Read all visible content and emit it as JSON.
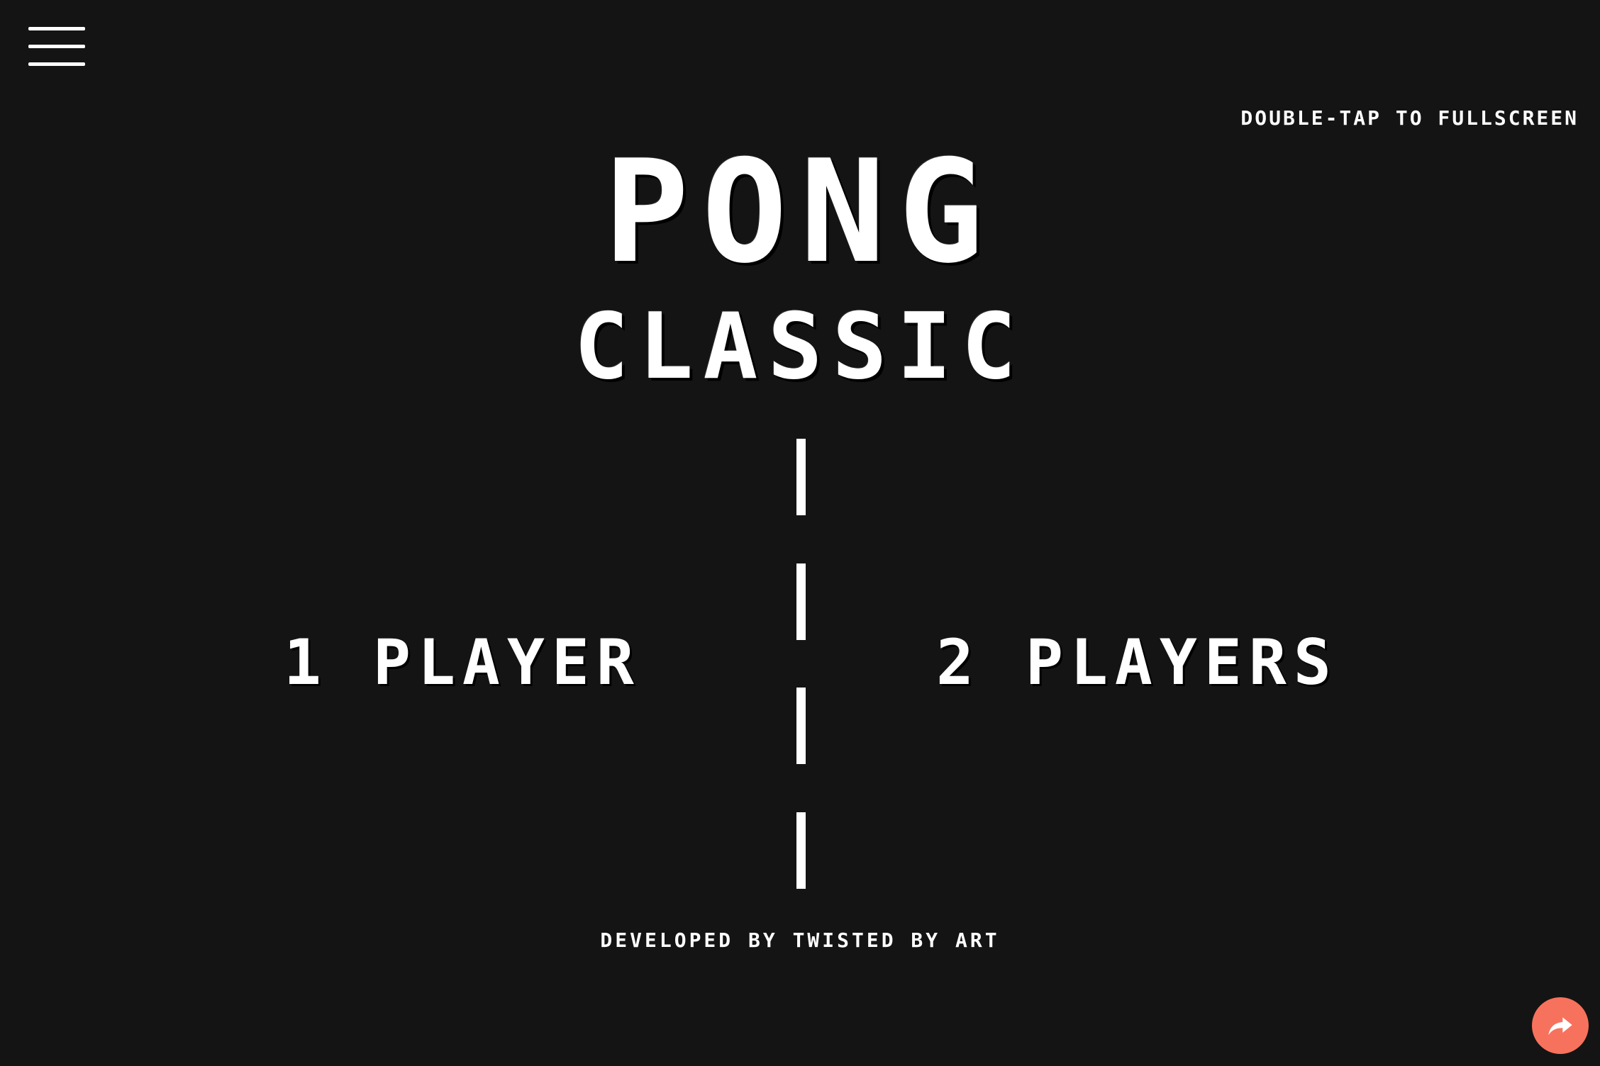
{
  "hud": {
    "fullscreen_hint": "Double-tap to fullscreen",
    "menu_icon": "hamburger-menu-icon"
  },
  "title": {
    "main": "Pong",
    "sub": "Classic"
  },
  "modes": {
    "one_player": "1 Player",
    "two_players": "2 Players"
  },
  "net": {
    "dash_count": 4
  },
  "footer": {
    "credit": "Developed by Twisted by Art"
  },
  "share": {
    "icon": "share-arrow-icon"
  },
  "colors": {
    "background": "#141414",
    "foreground": "#ffffff",
    "share_button": "#f7725c"
  }
}
